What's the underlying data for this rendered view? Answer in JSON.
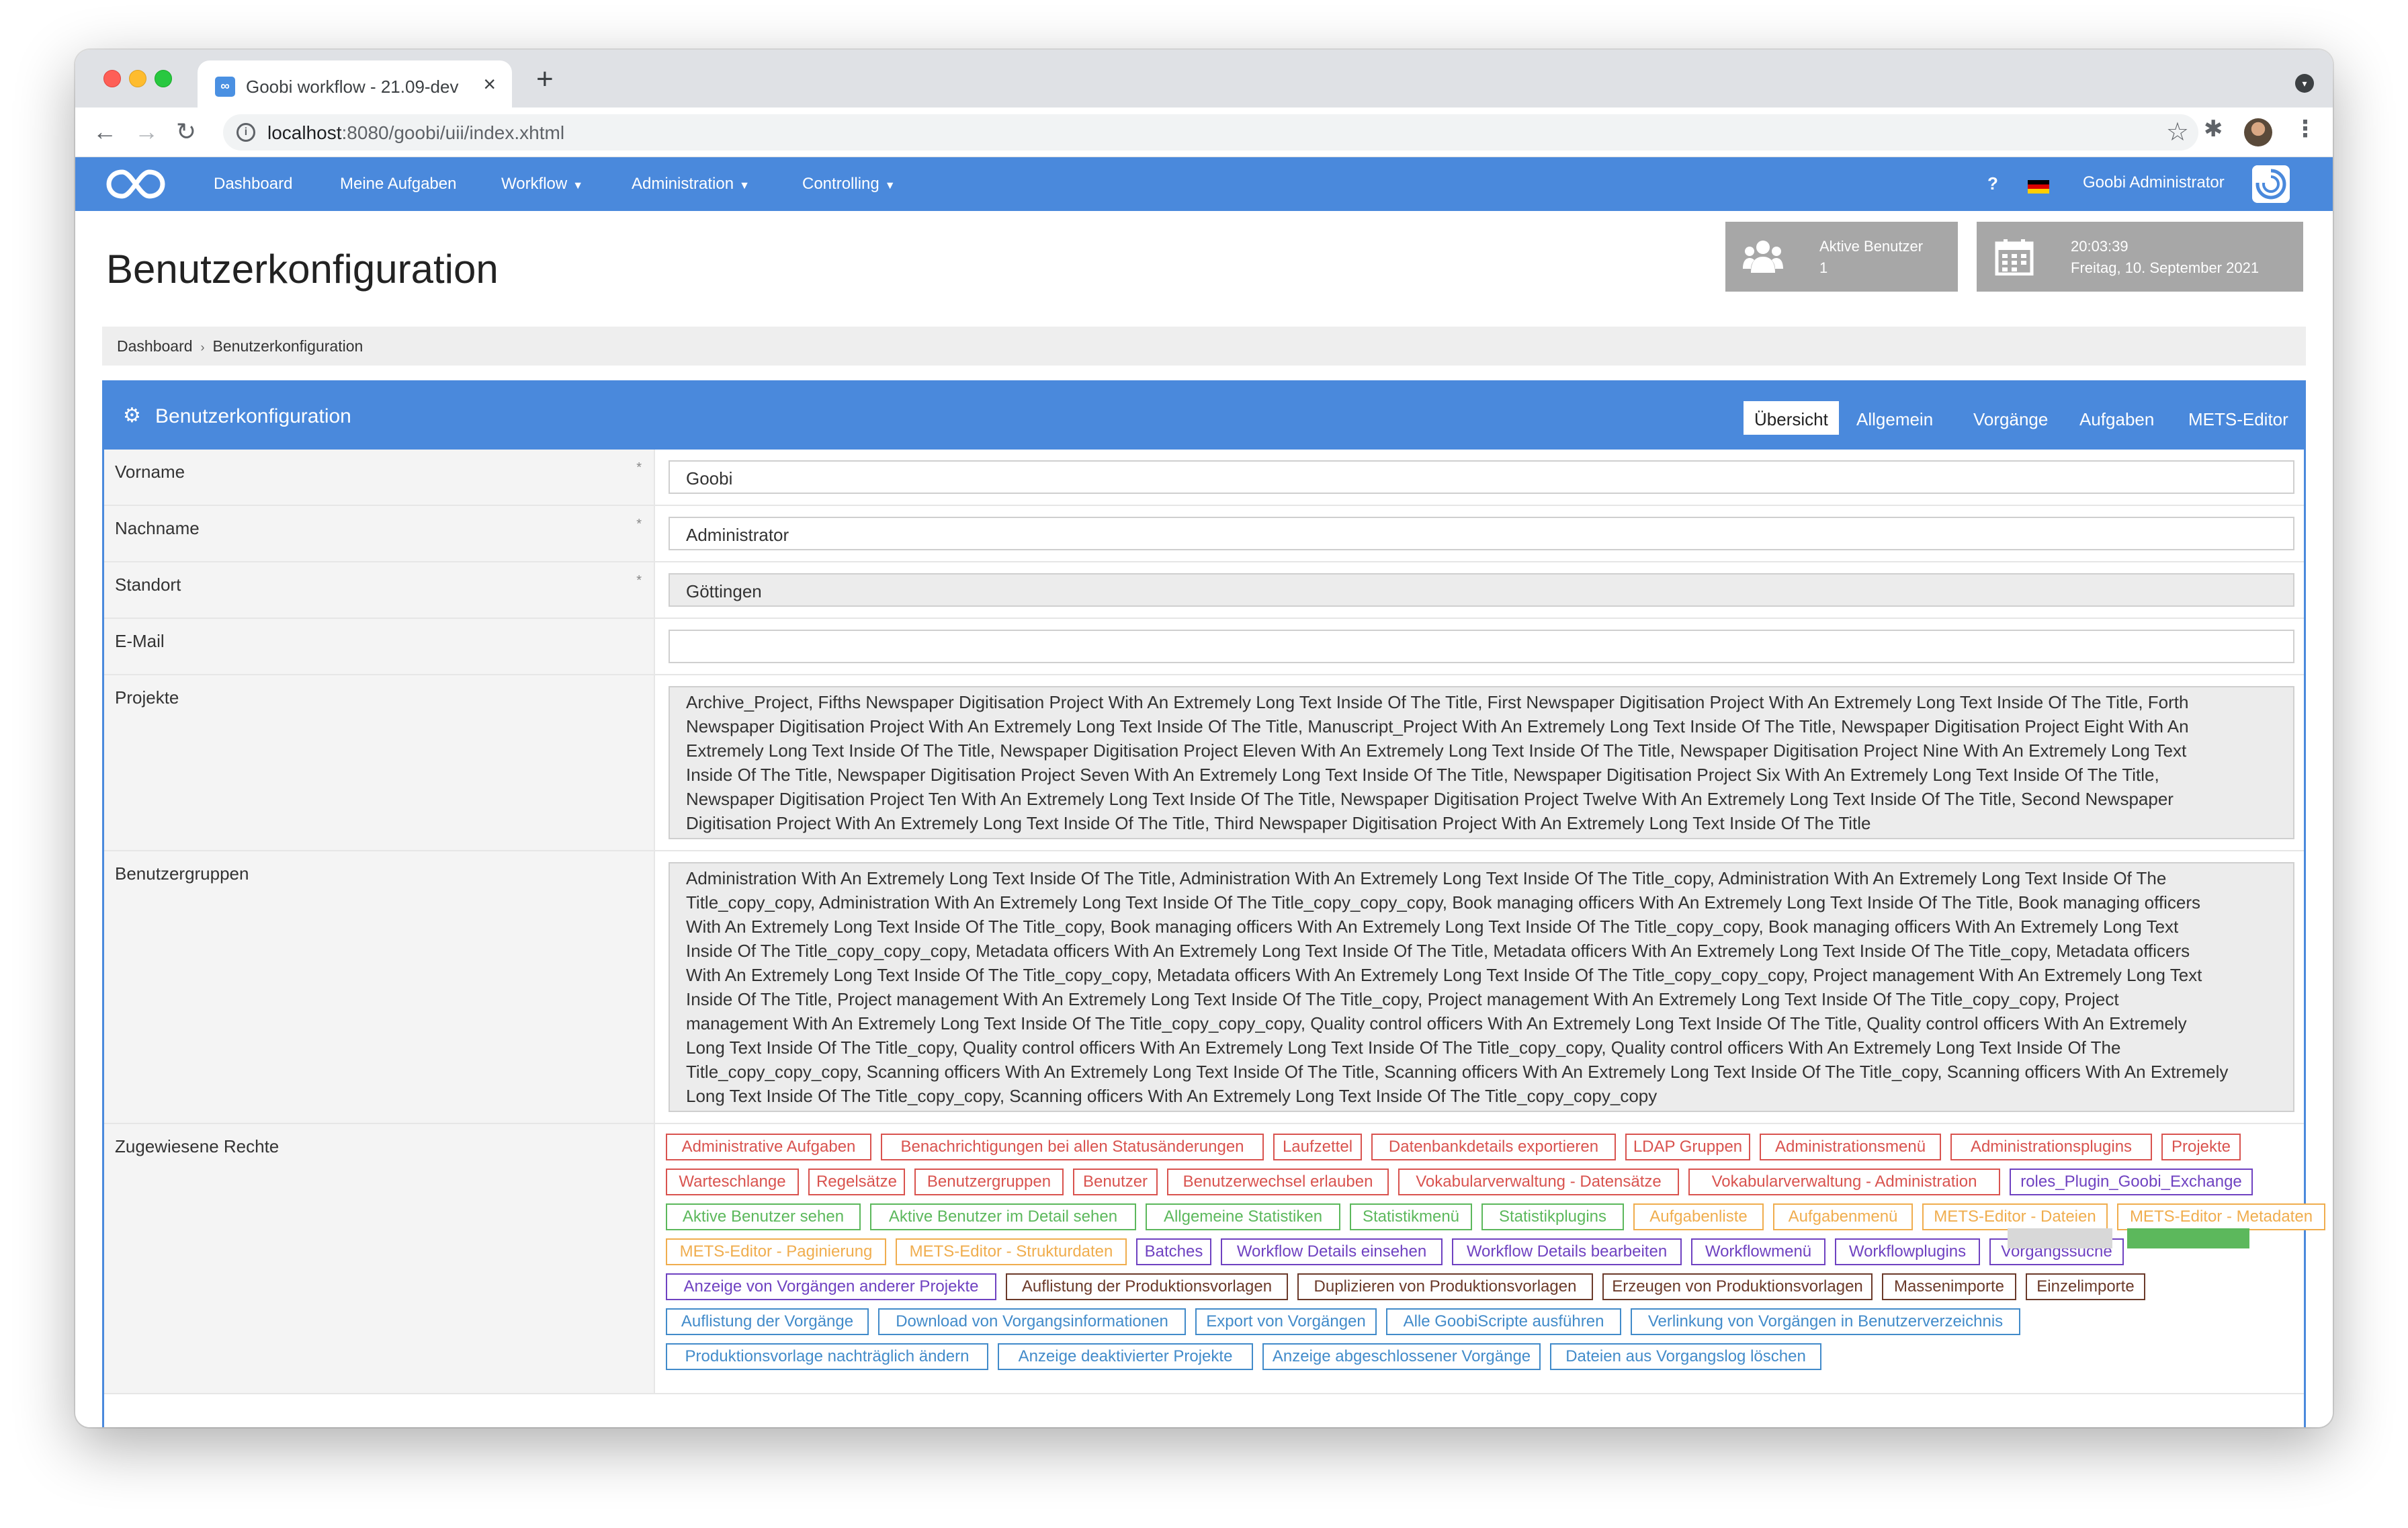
{
  "browser": {
    "tab_title": "Goobi workflow - 21.09-dev",
    "favicon": "∞",
    "url_host": "localhost",
    "url_path": ":8080/goobi/uii/index.xhtml"
  },
  "navbar": {
    "items": [
      {
        "label": "Dashboard",
        "dropdown": false
      },
      {
        "label": "Meine Aufgaben",
        "dropdown": false
      },
      {
        "label": "Workflow",
        "dropdown": true
      },
      {
        "label": "Administration",
        "dropdown": true
      },
      {
        "label": "Controlling",
        "dropdown": true
      }
    ],
    "help": "?",
    "user_name": "Goobi Administrator"
  },
  "header": {
    "title": "Benutzerkonfiguration",
    "active_users_label": "Aktive Benutzer",
    "active_users_count": "1",
    "time": "20:03:39",
    "date": "Freitag, 10. September 2021"
  },
  "breadcrumb": [
    "Dashboard",
    "Benutzerkonfiguration"
  ],
  "panel": {
    "title": "Benutzerkonfiguration",
    "tabs": [
      "Übersicht",
      "Allgemein",
      "Vorgänge",
      "Aufgaben",
      "METS-Editor"
    ],
    "active_tab": "Übersicht"
  },
  "form": {
    "vorname": {
      "label": "Vorname",
      "value": "Goobi",
      "required": "*"
    },
    "nachname": {
      "label": "Nachname",
      "value": "Administrator",
      "required": "*"
    },
    "standort": {
      "label": "Standort",
      "value": "Göttingen",
      "required": "*"
    },
    "email": {
      "label": "E-Mail",
      "value": ""
    },
    "projekte": {
      "label": "Projekte",
      "lines": [
        "Archive_Project, Fifths Newspaper Digitisation Project With An Extremely Long Text Inside Of The Title, First Newspaper Digitisation Project With An Extremely Long Text Inside Of The Title, Forth",
        "Newspaper Digitisation Project With An Extremely Long Text Inside Of The Title, Manuscript_Project With An Extremely Long Text Inside Of The Title, Newspaper Digitisation Project Eight With An",
        "Extremely Long Text Inside Of The Title, Newspaper Digitisation Project Eleven With An Extremely Long Text Inside Of The Title, Newspaper Digitisation Project Nine With An Extremely Long Text",
        "Inside Of The Title, Newspaper Digitisation Project Seven With An Extremely Long Text Inside Of The Title, Newspaper Digitisation Project Six With An Extremely Long Text Inside Of The Title,",
        "Newspaper Digitisation Project Ten With An Extremely Long Text Inside Of The Title, Newspaper Digitisation Project Twelve With An Extremely Long Text Inside Of The Title, Second Newspaper",
        "Digitisation Project With An Extremely Long Text Inside Of The Title, Third Newspaper Digitisation Project With An Extremely Long Text Inside Of The Title"
      ]
    },
    "benutzergruppen": {
      "label": "Benutzergruppen",
      "lines": [
        "Administration With An Extremely Long Text Inside Of The Title, Administration With An Extremely Long Text Inside Of The Title_copy, Administration With An Extremely Long Text Inside Of The",
        "Title_copy_copy, Administration With An Extremely Long Text Inside Of The Title_copy_copy_copy, Book managing officers With An Extremely Long Text Inside Of The Title, Book managing officers",
        "With An Extremely Long Text Inside Of The Title_copy, Book managing officers With An Extremely Long Text Inside Of The Title_copy_copy, Book managing officers With An Extremely Long Text",
        "Inside Of The Title_copy_copy_copy, Metadata officers With An Extremely Long Text Inside Of The Title, Metadata officers With An Extremely Long Text Inside Of The Title_copy, Metadata officers",
        "With An Extremely Long Text Inside Of The Title_copy_copy, Metadata officers With An Extremely Long Text Inside Of The Title_copy_copy_copy, Project management With An Extremely Long Text",
        "Inside Of The Title, Project management With An Extremely Long Text Inside Of The Title_copy, Project management With An Extremely Long Text Inside Of The Title_copy_copy, Project",
        "management With An Extremely Long Text Inside Of The Title_copy_copy_copy, Quality control officers With An Extremely Long Text Inside Of The Title, Quality control officers With An Extremely",
        "Long Text Inside Of The Title_copy, Quality control officers With An Extremely Long Text Inside Of The Title_copy_copy, Quality control officers With An Extremely Long Text Inside Of The",
        "Title_copy_copy_copy, Scanning officers With An Extremely Long Text Inside Of The Title, Scanning officers With An Extremely Long Text Inside Of The Title_copy, Scanning officers With An Extremely",
        "Long Text Inside Of The Title_copy_copy, Scanning officers With An Extremely Long Text Inside Of The Title_copy_copy_copy"
      ]
    },
    "rechte": {
      "label": "Zugewiesene Rechte",
      "rows": [
        [
          {
            "label": "Administrative Aufgaben",
            "color": "red"
          },
          {
            "label": "Benachrichtigungen bei allen Statusänderungen",
            "color": "red"
          },
          {
            "label": "Laufzettel",
            "color": "red"
          },
          {
            "label": "Datenbankdetails exportieren",
            "color": "red"
          },
          {
            "label": "LDAP Gruppen",
            "color": "red"
          },
          {
            "label": "Administrationsmenü",
            "color": "red"
          },
          {
            "label": "Administrationsplugins",
            "color": "red"
          },
          {
            "label": "Projekte",
            "color": "red"
          }
        ],
        [
          {
            "label": "Warteschlange",
            "color": "red"
          },
          {
            "label": "Regelsätze",
            "color": "red"
          },
          {
            "label": "Benutzergruppen",
            "color": "red"
          },
          {
            "label": "Benutzer",
            "color": "red"
          },
          {
            "label": "Benutzerwechsel erlauben",
            "color": "red"
          },
          {
            "label": "Vokabularverwaltung - Datensätze",
            "color": "red"
          },
          {
            "label": "Vokabularverwaltung - Administration",
            "color": "red"
          },
          {
            "label": "roles_Plugin_Goobi_Exchange",
            "color": "purple"
          }
        ],
        [
          {
            "label": "Aktive Benutzer sehen",
            "color": "green"
          },
          {
            "label": "Aktive Benutzer im Detail sehen",
            "color": "green"
          },
          {
            "label": "Allgemeine Statistiken",
            "color": "green"
          },
          {
            "label": "Statistikmenü",
            "color": "green"
          },
          {
            "label": "Statistikplugins",
            "color": "green"
          },
          {
            "label": "Aufgabenliste",
            "color": "orange"
          },
          {
            "label": "Aufgabenmenü",
            "color": "orange"
          },
          {
            "label": "METS-Editor - Dateien",
            "color": "orange"
          },
          {
            "label": "METS-Editor - Metadaten",
            "color": "orange"
          }
        ],
        [
          {
            "label": "METS-Editor - Paginierung",
            "color": "orange"
          },
          {
            "label": "METS-Editor - Strukturdaten",
            "color": "orange"
          },
          {
            "label": "Batches",
            "color": "purple"
          },
          {
            "label": "Workflow Details einsehen",
            "color": "purple"
          },
          {
            "label": "Workflow Details bearbeiten",
            "color": "purple"
          },
          {
            "label": "Workflowmenü",
            "color": "purple"
          },
          {
            "label": "Workflowplugins",
            "color": "purple"
          },
          {
            "label": "Vorgangssuche",
            "color": "purple"
          }
        ],
        [
          {
            "label": "Anzeige von Vorgängen anderer Projekte",
            "color": "purple"
          },
          {
            "label": "Auflistung der Produktionsvorlagen",
            "color": "brown"
          },
          {
            "label": "Duplizieren von Produktionsvorlagen",
            "color": "brown"
          },
          {
            "label": "Erzeugen von Produktionsvorlagen",
            "color": "brown"
          },
          {
            "label": "Massenimporte",
            "color": "brown"
          },
          {
            "label": "Einzelimporte",
            "color": "brown"
          }
        ],
        [
          {
            "label": "Auflistung der Vorgänge",
            "color": "blue"
          },
          {
            "label": "Download von Vorgangsinformationen",
            "color": "blue"
          },
          {
            "label": "Export von Vorgängen",
            "color": "blue"
          },
          {
            "label": "Alle GoobiScripte ausführen",
            "color": "blue"
          },
          {
            "label": "Verlinkung von Vorgängen in Benutzerverzeichnis",
            "color": "blue"
          }
        ],
        [
          {
            "label": "Produktionsvorlage nachträglich ändern",
            "color": "blue"
          },
          {
            "label": "Anzeige deaktivierter Projekte",
            "color": "blue"
          },
          {
            "label": "Anzeige abgeschlossener Vorgänge",
            "color": "blue"
          },
          {
            "label": "Dateien aus Vorgangslog löschen",
            "color": "blue"
          }
        ]
      ]
    }
  },
  "colors": {
    "primary": "#4a89dc",
    "red": "#d9534f",
    "purple": "#6f42c1",
    "green": "#5cb85c",
    "orange": "#f0ad4e",
    "brown": "#6b3a2a",
    "blue": "#428bca"
  },
  "icons": {
    "logo": "infinity-logo",
    "active_users": "users-icon",
    "calendar": "calendar-icon",
    "panel": "gear-icon",
    "flag": "german-flag-icon"
  }
}
